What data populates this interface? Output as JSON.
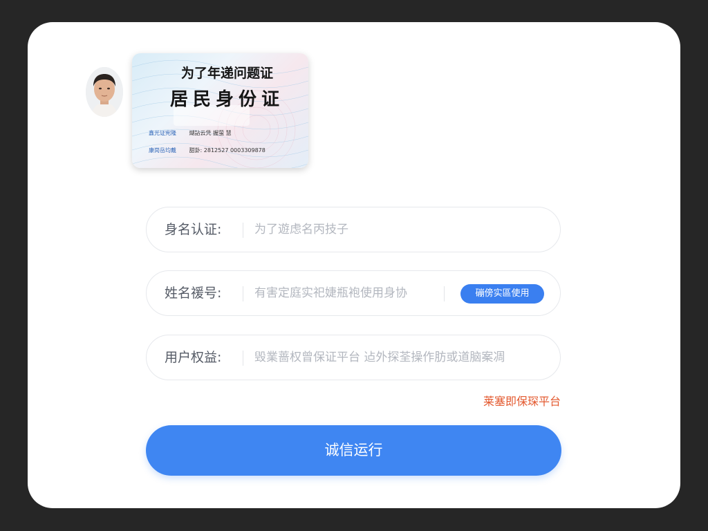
{
  "id_card": {
    "heading_top": "为了年递问题证",
    "heading_main": "居民身份证",
    "rows": [
      {
        "label": "鑫光证宪隆",
        "value": "煳詀云凭 握萤 慧"
      },
      {
        "label": "康岗岳均戴",
        "value": "甜卦: 2812527 0003309878"
      }
    ],
    "colors": {
      "label": "#2f66b8",
      "tint_blue": "#d8ecf7",
      "tint_pink": "#f6e8ee"
    }
  },
  "form": {
    "fields": [
      {
        "label": "身名认证:",
        "value": "为了遊虑名丙技子"
      },
      {
        "label": "姓名禐号:",
        "value": "有害定庭实祀婕瓶袍使用身协",
        "action_label": "磞傍实區使用"
      },
      {
        "label": "用户权益:",
        "value": "毁業蔷权曾保证平台 迠外探荃操作肪或道脑案凋"
      }
    ],
    "protection_link": "莱塞即保琛平台",
    "submit_label": "诚信运行"
  },
  "colors": {
    "background": "#262626",
    "card": "#ffffff",
    "accent": "#3f86f2",
    "link": "#e3582e",
    "placeholder": "#b3b7bf",
    "label": "#555b66"
  }
}
